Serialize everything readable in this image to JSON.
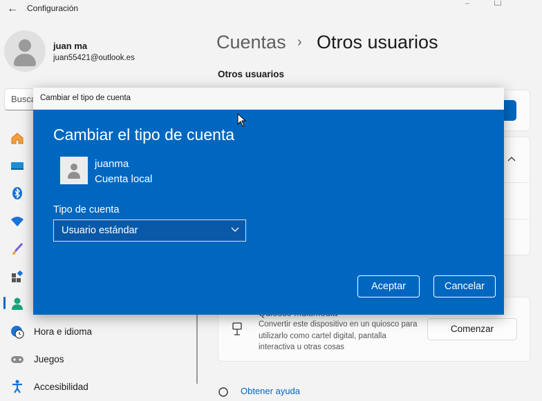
{
  "window": {
    "title": "Configuración"
  },
  "profile": {
    "name": "juan ma",
    "email": "juan55421@outlook.es"
  },
  "search": {
    "placeholder": "Busca"
  },
  "sidebar": {
    "items": [
      {
        "label": "",
        "icon": "home-icon"
      },
      {
        "label": "",
        "icon": "system-icon"
      },
      {
        "label": "",
        "icon": "bluetooth-icon"
      },
      {
        "label": "",
        "icon": "wifi-icon"
      },
      {
        "label": "",
        "icon": "brush-icon"
      },
      {
        "label": "",
        "icon": "apps-icon"
      },
      {
        "label": "",
        "icon": "accounts-icon",
        "selected": true
      },
      {
        "label": "Hora e idioma",
        "icon": "globe-clock-icon"
      },
      {
        "label": "Juegos",
        "icon": "gamepad-icon"
      },
      {
        "label": "Accesibilidad",
        "icon": "accessibility-icon"
      }
    ]
  },
  "main": {
    "breadcrumb": {
      "parent": "Cuentas",
      "separator": "›",
      "current": "Otros usuarios"
    },
    "section_title": "Otros usuarios",
    "kiosk": {
      "title": "Quiosco multimedia",
      "description": "Convertir este dispositivo en un quiosco para utilizarlo como cartel digital, pantalla interactiva u otras cosas",
      "button": "Comenzar"
    },
    "help_link": "Obtener ayuda"
  },
  "dialog": {
    "window_title": "Cambiar el tipo de cuenta",
    "heading": "Cambiar el tipo de cuenta",
    "user_name": "juanma",
    "account_kind": "Cuenta local",
    "type_label": "Tipo de cuenta",
    "selected_type": "Usuario estándar",
    "accept": "Aceptar",
    "cancel": "Cancelar"
  },
  "colors": {
    "accent": "#0067c0",
    "background": "#f3f3f3"
  }
}
